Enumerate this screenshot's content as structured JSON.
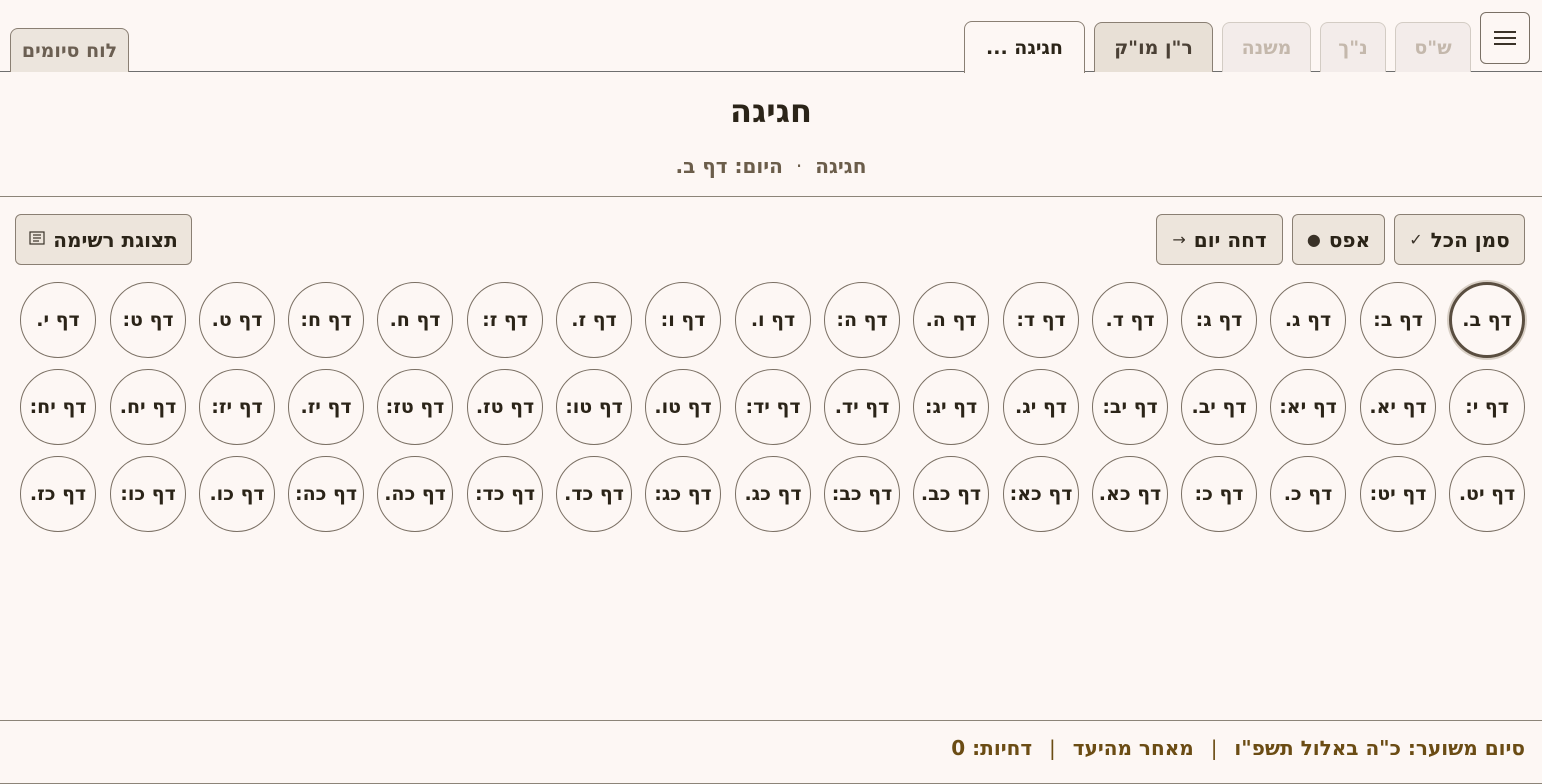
{
  "tabs": {
    "shas": "ש\"ס",
    "nach": "נ\"ך",
    "mishna": "משנה",
    "ran": "ר\"ן מו\"ק",
    "active": "חגיגה ...",
    "siyum_board": "לוח סיומים"
  },
  "header": {
    "title": "חגיגה",
    "tractate": "חגיגה",
    "dot": "·",
    "today": "היום: דף ב."
  },
  "toolbar": {
    "mark_all": "סמן הכל",
    "mark_all_icon": "✓",
    "reset": "אפס",
    "reset_icon": "●",
    "postpone": "דחה יום",
    "postpone_icon": "→",
    "list_view": "תצוגת רשימה",
    "list_view_icon": "list-icon"
  },
  "dafim": [
    "דף ב.",
    "דף ב:",
    "דף ג.",
    "דף ג:",
    "דף ד.",
    "דף ד:",
    "דף ה.",
    "דף ה:",
    "דף ו.",
    "דף ו:",
    "דף ז.",
    "דף ז:",
    "דף ח.",
    "דף ח:",
    "דף ט.",
    "דף ט:",
    "דף י.",
    "דף י:",
    "דף יא.",
    "דף יא:",
    "דף יב.",
    "דף יב:",
    "דף יג.",
    "דף יג:",
    "דף יד.",
    "דף יד:",
    "דף טו.",
    "דף טו:",
    "דף טז.",
    "דף טז:",
    "דף יז.",
    "דף יז:",
    "דף יח.",
    "דף יח:",
    "דף יט.",
    "דף יט:",
    "דף כ.",
    "דף כ:",
    "דף כא.",
    "דף כא:",
    "דף כב.",
    "דף כב:",
    "דף כג.",
    "דף כג:",
    "דף כד.",
    "דף כד:",
    "דף כה.",
    "דף כה:",
    "דף כו.",
    "דף כו:",
    "דף כז."
  ],
  "today_index": 0,
  "footer": {
    "estimated": "סיום משוער: כ\"ה באלול תשפ\"ו",
    "status": "מאחר מהיעד",
    "postponements": "דחיות: 0",
    "separator": "|"
  },
  "colors": {
    "background": "#fdf7f4",
    "accent": "#6b4c14",
    "border": "#7a6f63"
  }
}
